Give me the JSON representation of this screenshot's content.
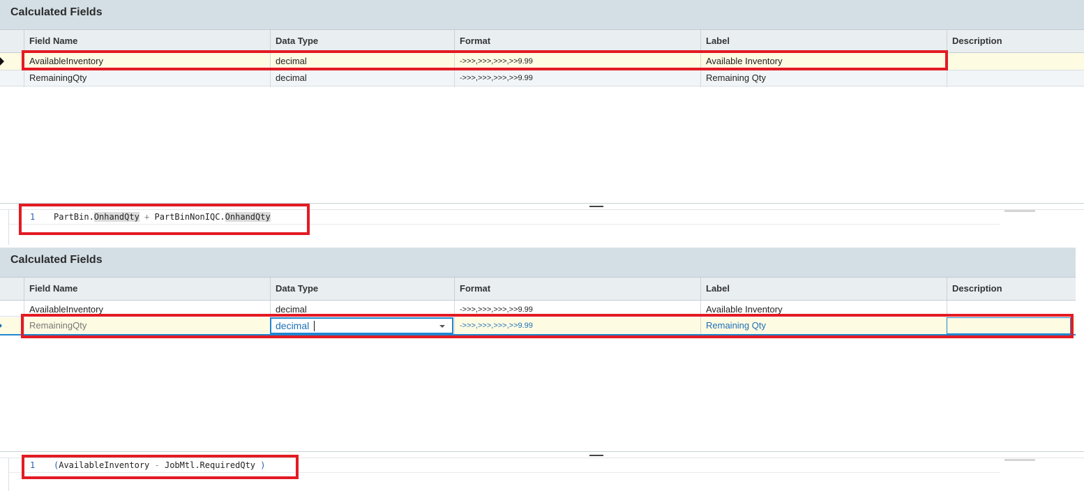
{
  "panels": [
    {
      "title": "Calculated Fields",
      "columns": [
        "Field Name",
        "Data Type",
        "Format",
        "Label",
        "Description"
      ],
      "rows": [
        {
          "field": "AvailableInventory",
          "type": "decimal",
          "format": "->>>,>>>,>>>,>>9.99",
          "label": "Available Inventory",
          "description": ""
        },
        {
          "field": "RemainingQty",
          "type": "decimal",
          "format": "->>>,>>>,>>>,>>9.99",
          "label": "Remaining Qty",
          "description": ""
        }
      ],
      "expression": {
        "line_number": "1",
        "tokens": [
          "PartBin.",
          "OnhandQty",
          " + ",
          "PartBinNonIQC.",
          "OnhandQty"
        ]
      }
    },
    {
      "title": "Calculated Fields",
      "columns": [
        "Field Name",
        "Data Type",
        "Format",
        "Label",
        "Description"
      ],
      "rows": [
        {
          "field": "AvailableInventory",
          "type": "decimal",
          "format": "->>>,>>>,>>>,>>9.99",
          "label": "Available Inventory",
          "description": ""
        },
        {
          "field": "RemainingQty",
          "type": "decimal",
          "format": "->>>,>>>,>>>,>>9.99",
          "label": "Remaining Qty",
          "description": ""
        }
      ],
      "expression": {
        "line_number": "1",
        "tokens": [
          "(",
          "AvailableInventory",
          " - ",
          "JobMtl.RequiredQty",
          " )"
        ]
      }
    }
  ],
  "colors": {
    "highlight_red": "#e31b23",
    "header_bg": "#d4dfe5",
    "selected_row_bg": "#fefbe3",
    "edit_blue": "#1c6fb8"
  },
  "icons": {
    "row_indicator": "row-pointer-icon",
    "dropdown": "chevron-down-icon",
    "splitter": "drag-handle-icon"
  }
}
